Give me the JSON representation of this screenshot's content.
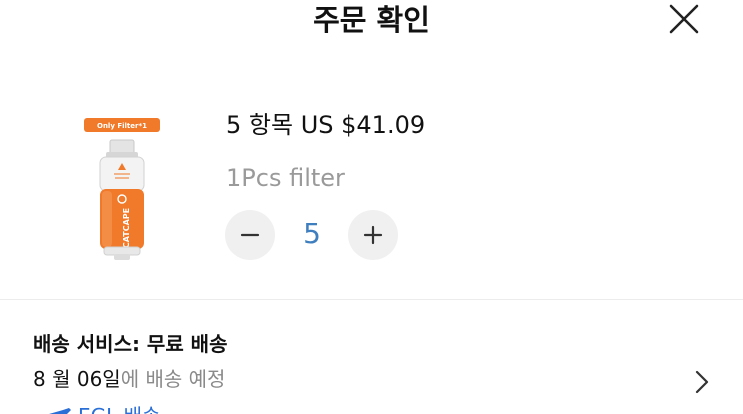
{
  "header": {
    "title": "주문 확인"
  },
  "product": {
    "image_badge": "Only Filter*1",
    "image_brand": "CATCAPE",
    "quantity_label": "5 항목",
    "price": "US $41.09",
    "variant": "1Pcs filter",
    "quantity": "5"
  },
  "shipping": {
    "title": "배송 서비스:  무료 배송",
    "date_strong": "8 월 06일",
    "date_weak": "에 배송 예정",
    "carrier": "EGL 배송"
  },
  "colors": {
    "accent_orange": "#f07a2a",
    "quantity_blue": "#3f7fbf",
    "carrier_blue": "#2a6fd8"
  }
}
